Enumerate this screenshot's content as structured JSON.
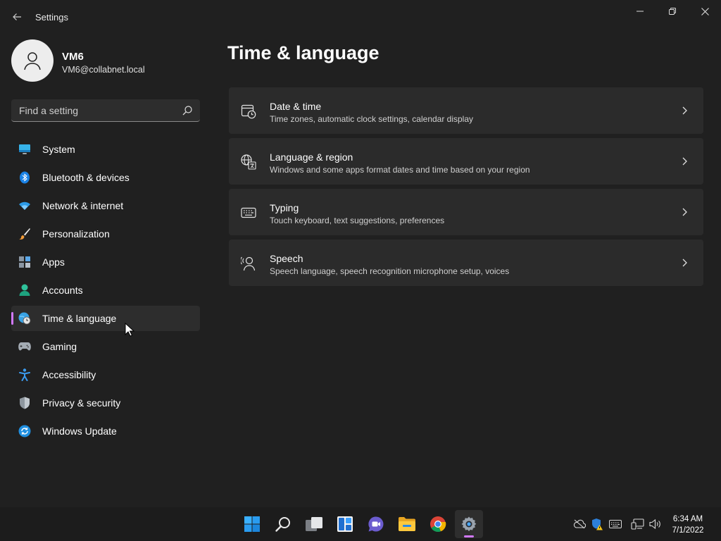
{
  "window": {
    "title": "Settings"
  },
  "user": {
    "name": "VM6",
    "email": "VM6@collabnet.local"
  },
  "search": {
    "placeholder": "Find a setting"
  },
  "sidebar": {
    "items": [
      {
        "label": "System",
        "icon": "monitor-icon"
      },
      {
        "label": "Bluetooth & devices",
        "icon": "bluetooth-icon"
      },
      {
        "label": "Network & internet",
        "icon": "wifi-icon"
      },
      {
        "label": "Personalization",
        "icon": "brush-icon"
      },
      {
        "label": "Apps",
        "icon": "apps-icon"
      },
      {
        "label": "Accounts",
        "icon": "account-icon"
      },
      {
        "label": "Time & language",
        "icon": "globe-clock-icon",
        "selected": true
      },
      {
        "label": "Gaming",
        "icon": "gamepad-icon"
      },
      {
        "label": "Accessibility",
        "icon": "accessibility-icon"
      },
      {
        "label": "Privacy & security",
        "icon": "shield-icon"
      },
      {
        "label": "Windows Update",
        "icon": "update-icon"
      }
    ]
  },
  "main": {
    "title": "Time & language",
    "cards": [
      {
        "title": "Date & time",
        "description": "Time zones, automatic clock settings, calendar display",
        "icon": "calendar-clock-icon"
      },
      {
        "title": "Language & region",
        "description": "Windows and some apps format dates and time based on your region",
        "icon": "language-icon"
      },
      {
        "title": "Typing",
        "description": "Touch keyboard, text suggestions, preferences",
        "icon": "keyboard-icon"
      },
      {
        "title": "Speech",
        "description": "Speech language, speech recognition microphone setup, voices",
        "icon": "speech-icon"
      }
    ]
  },
  "taskbar": {
    "apps": [
      "start-icon",
      "search-icon",
      "task-view-icon",
      "widgets-icon",
      "chat-icon",
      "file-explorer-icon",
      "chrome-icon",
      "settings-icon"
    ],
    "clock": {
      "time": "6:34 AM",
      "date": "7/1/2022"
    }
  },
  "colors": {
    "accent": "#d279ff",
    "background": "#202020",
    "card": "#2b2b2b"
  }
}
